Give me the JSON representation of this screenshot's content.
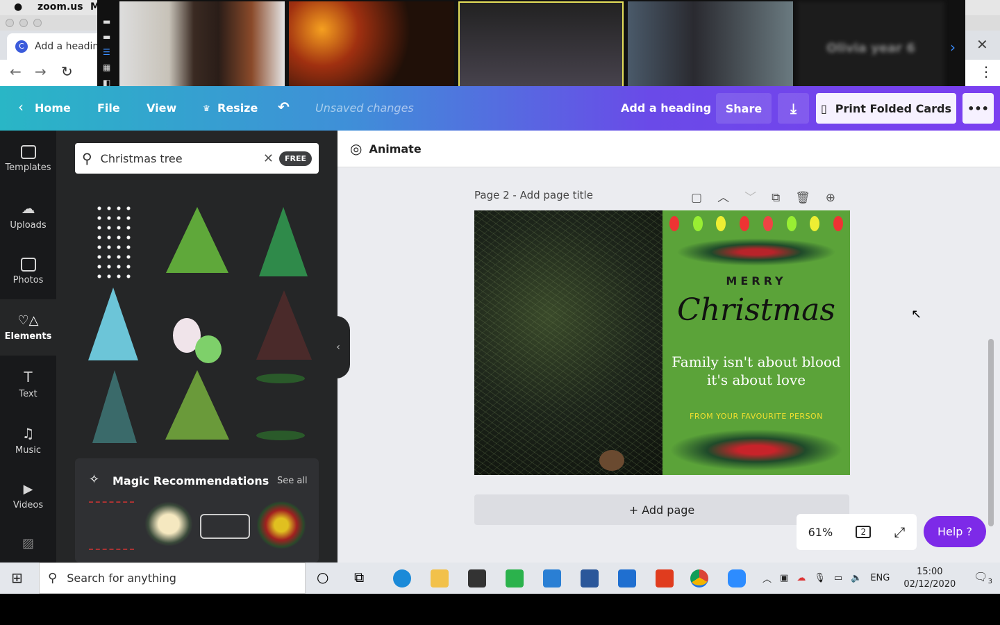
{
  "mac": {
    "app": "zoom.us",
    "menu_partial": "M"
  },
  "browser": {
    "tab_title": "Add a heading",
    "tab_icon": "C"
  },
  "zoom": {
    "participant_blurred_name": "Olivia year 6"
  },
  "header": {
    "home": "Home",
    "file": "File",
    "view": "View",
    "resize": "Resize",
    "status": "Unsaved changes",
    "title": "Add a heading",
    "share": "Share",
    "print": "Print Folded Cards",
    "more": "•••"
  },
  "sidebar": {
    "items": [
      {
        "label": "Templates",
        "icon": "templates-icon"
      },
      {
        "label": "Uploads",
        "icon": "upload-icon"
      },
      {
        "label": "Photos",
        "icon": "photo-icon"
      },
      {
        "label": "Elements",
        "icon": "elements-icon",
        "active": true
      },
      {
        "label": "Text",
        "icon": "text-icon"
      },
      {
        "label": "Music",
        "icon": "music-icon"
      },
      {
        "label": "Videos",
        "icon": "video-icon"
      }
    ]
  },
  "panel": {
    "search_value": "Christmas tree",
    "free_badge": "FREE",
    "magic_title": "Magic Recommendations",
    "see_all": "See all"
  },
  "editor": {
    "animate": "Animate",
    "page_label": "Page 2 - Add page title",
    "add_page": "+ Add page",
    "zoom": "61%",
    "page_count": "2",
    "help": "Help ?"
  },
  "card": {
    "merry": "MERRY",
    "christmas": "Christmas",
    "quote1": "Family isn't about blood",
    "quote2": "it's about love",
    "from": "FROM YOUR FAVOURITE PERSON",
    "bg": "#5ba339"
  },
  "taskbar": {
    "search_placeholder": "Search for anything",
    "lang": "ENG",
    "time": "15:00",
    "date": "02/12/2020",
    "notifications": "3"
  },
  "colors": {
    "accent": "#7d2ae8",
    "sidebar": "#18191b",
    "panel": "#252627"
  }
}
